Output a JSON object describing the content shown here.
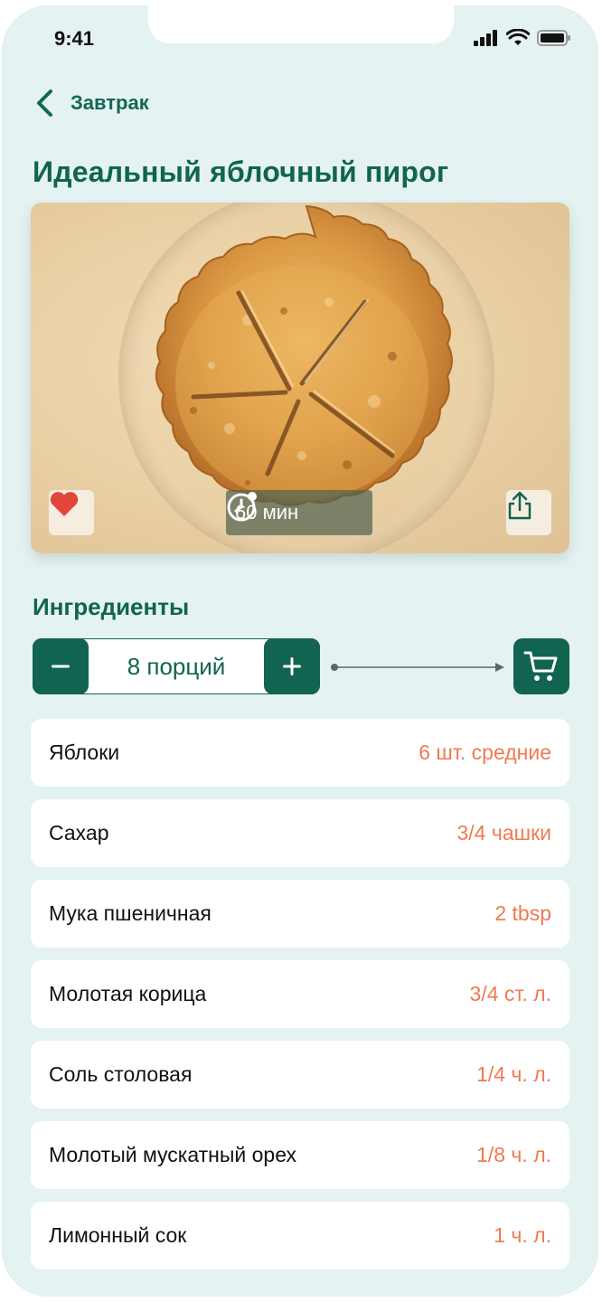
{
  "status_bar": {
    "time": "9:41"
  },
  "nav": {
    "back_label": "Завтрак"
  },
  "recipe": {
    "title": "Идеальный яблочный пирог",
    "cook_time": "60 мин"
  },
  "ingredients_section": {
    "title": "Ингредиенты",
    "servings_label": "8 порций",
    "minus_label": "−",
    "plus_label": "+"
  },
  "ingredients": [
    {
      "name": "Яблоки",
      "qty": "6 шт. средние"
    },
    {
      "name": "Сахар",
      "qty": "3/4 чашки"
    },
    {
      "name": "Мука пшеничная",
      "qty": "2 tbsp"
    },
    {
      "name": "Молотая корица",
      "qty": "3/4 ст. л."
    },
    {
      "name": "Соль столовая",
      "qty": "1/4 ч. л."
    },
    {
      "name": "Молотый мускатный орех",
      "qty": "1/8 ч. л."
    },
    {
      "name": "Лимонный сок",
      "qty": "1 ч. л."
    }
  ],
  "colors": {
    "brand": "#11644f",
    "background": "#e4f3f1",
    "accent_quantity": "#ef7a52",
    "favorite": "#e2453c"
  },
  "icons": {
    "back": "chevron-left-icon",
    "favorite": "heart-icon",
    "timer": "clock-icon",
    "share": "share-icon",
    "cart": "cart-icon"
  }
}
